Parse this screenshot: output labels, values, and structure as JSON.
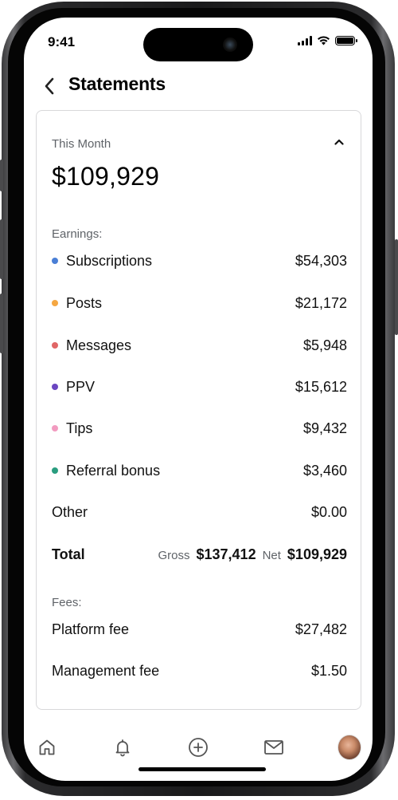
{
  "status_bar": {
    "time": "9:41"
  },
  "header": {
    "back_icon": "chevron-left-icon",
    "title": "Statements"
  },
  "summary": {
    "period_label": "This Month",
    "collapse_icon": "chevron-up-icon",
    "total": "$109,929"
  },
  "earnings": {
    "label": "Earnings:",
    "items": [
      {
        "label": "Subscriptions",
        "value": "$54,303",
        "color": "#4a7fd6"
      },
      {
        "label": "Posts",
        "value": "$21,172",
        "color": "#f5a742"
      },
      {
        "label": "Messages",
        "value": "$5,948",
        "color": "#e06666"
      },
      {
        "label": "PPV",
        "value": "$15,612",
        "color": "#6b46c1"
      },
      {
        "label": "Tips",
        "value": "$9,432",
        "color": "#f29bc0"
      },
      {
        "label": "Referral bonus",
        "value": "$3,460",
        "color": "#2a9d7f"
      }
    ],
    "other": {
      "label": "Other",
      "value": "$0.00"
    },
    "total": {
      "label": "Total",
      "gross_label": "Gross",
      "gross_value": "$137,412",
      "net_label": "Net",
      "net_value": "$109,929"
    }
  },
  "fees": {
    "label": "Fees:",
    "items": [
      {
        "label": "Platform fee",
        "value": "$27,482"
      },
      {
        "label": "Management fee",
        "value": "$1.50"
      }
    ]
  },
  "tabbar": {
    "items": [
      "home-icon",
      "bell-icon",
      "plus-circle-icon",
      "mail-icon",
      "avatar"
    ]
  }
}
